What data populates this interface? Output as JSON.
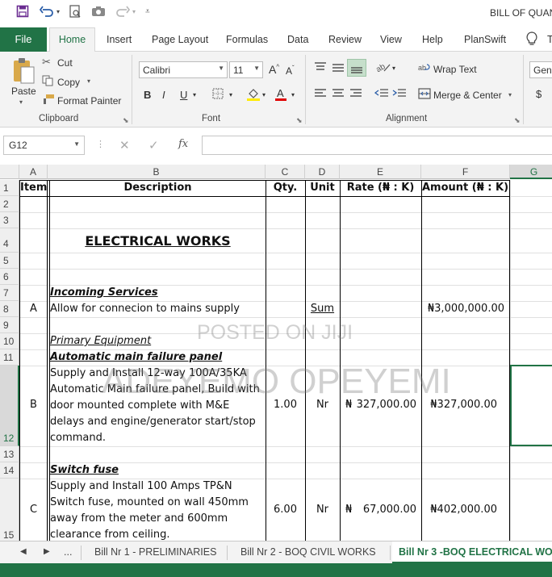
{
  "qat": {
    "title": "BILL OF QUAN",
    "save_icon": "save-icon",
    "undo_icon": "undo-icon",
    "redo_icon": "redo-icon"
  },
  "tabs": {
    "file": "File",
    "home": "Home",
    "insert": "Insert",
    "page_layout": "Page Layout",
    "formulas": "Formulas",
    "data": "Data",
    "review": "Review",
    "view": "View",
    "help": "Help",
    "planswift": "PlanSwift",
    "tell_me": "T"
  },
  "ribbon": {
    "clipboard": {
      "paste": "Paste",
      "cut": "Cut",
      "copy": "Copy",
      "format_painter": "Format Painter",
      "label": "Clipboard"
    },
    "font": {
      "name": "Calibri",
      "size": "11",
      "bold": "B",
      "italic": "I",
      "underline": "U",
      "label": "Font"
    },
    "alignment": {
      "wrap_text": "Wrap Text",
      "merge_center": "Merge & Center",
      "label": "Alignment"
    },
    "number": {
      "format": "Gene",
      "currency": "$"
    }
  },
  "formula_bar": {
    "name_box": "G12",
    "fx": "fx",
    "value": ""
  },
  "grid": {
    "columns": [
      "A",
      "B",
      "C",
      "D",
      "E",
      "F",
      "G"
    ],
    "rows": [
      "1",
      "2",
      "3",
      "4",
      "5",
      "6",
      "7",
      "8",
      "9",
      "10",
      "11",
      "12",
      "13",
      "14",
      "15"
    ],
    "header": {
      "item": "Item",
      "description": "Description",
      "qty": "Qty.",
      "unit": "Unit",
      "rate": "Rate (₦ : K)",
      "amount": "Amount (₦ : K)"
    },
    "title": "ELECTRICAL WORKS",
    "incoming_services": "Incoming Services",
    "row8": {
      "item": "A",
      "desc": "Allow for connecion to mains supply",
      "unit": "Sum",
      "amount": "₦3,000,000.00"
    },
    "primary_equipment": "Primary Equipment",
    "amf_panel": "Automatic main failure panel",
    "row12": {
      "item": "B",
      "desc": "Supply and Install 12-way 100A/35KA Automatic Main failure panel, Build with door mounted complete with M&E delays and engine/generator start/stop command.",
      "qty": "1.00",
      "unit": "Nr",
      "rate_symbol": "₦",
      "rate": "327,000.00",
      "amount": "₦327,000.00"
    },
    "switch_fuse": "Switch fuse",
    "row15": {
      "item": "C",
      "desc": "Supply and Install 100 Amps TP&N Switch fuse, mounted on wall 450mm away from the meter and 600mm clearance from ceiling.",
      "qty": "6.00",
      "unit": "Nr",
      "rate_symbol": "₦",
      "rate": "67,000.00",
      "amount": "₦402,000.00"
    }
  },
  "watermarks": {
    "posted": "POSTED ON JIJI",
    "name": "ADEYEMO OPEYEMI"
  },
  "sheets": {
    "more": "...",
    "tab1": "Bill Nr 1 - PRELIMINARIES",
    "tab2": "Bill Nr 2 - BOQ CIVIL WORKS",
    "tab3": "Bill Nr 3 -BOQ ELECTRICAL WO"
  },
  "colors": {
    "accent": "#217346"
  }
}
